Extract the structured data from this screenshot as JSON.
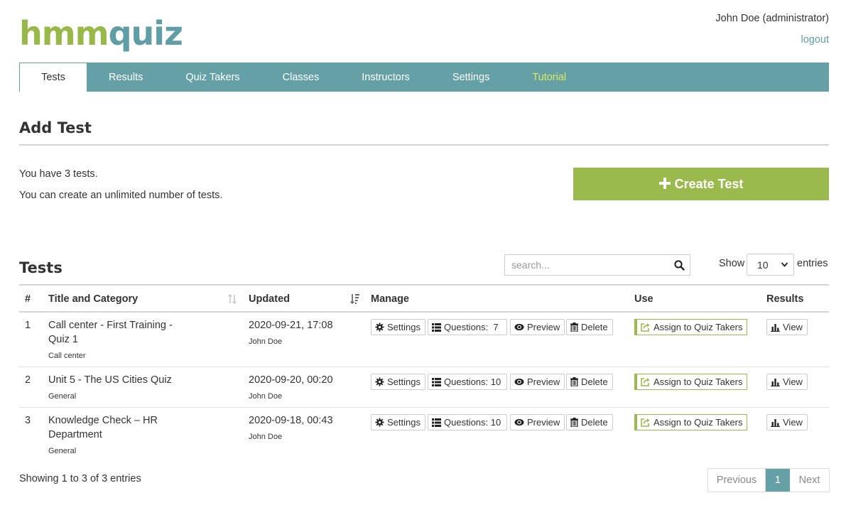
{
  "brand": {
    "logo_part1": "hmm",
    "logo_part2": "quiz"
  },
  "user": {
    "name": "John Doe (administrator)",
    "logout": "logout"
  },
  "nav": {
    "tabs": [
      "Tests",
      "Results",
      "Quiz Takers",
      "Classes",
      "Instructors",
      "Settings",
      "Tutorial"
    ],
    "active": "Tests"
  },
  "add_test": {
    "title": "Add Test",
    "count_text": "You have 3 tests.",
    "limit_text": "You can create an unlimited number of tests.",
    "create_button": "Create Test"
  },
  "tests": {
    "title": "Tests",
    "search_placeholder": "search...",
    "show_label": "Show",
    "entries_value": "10",
    "entries_label": "entries",
    "columns": [
      "#",
      "Title and Category",
      "Updated",
      "Manage",
      "Use",
      "Results"
    ],
    "rows": [
      {
        "num": "1",
        "title_line1": "Call center - First Training -",
        "title_line2": "Quiz 1",
        "category": "Call center",
        "updated": "2020-09-21, 17:08",
        "author": "John Doe",
        "questions": "Questions:  7"
      },
      {
        "num": "2",
        "title_line1": "Unit 5 - The US Cities Quiz",
        "title_line2": "",
        "category": "General",
        "updated": "2020-09-20, 00:20",
        "author": "John Doe",
        "questions": "Questions: 10"
      },
      {
        "num": "3",
        "title_line1": "Knowledge Check – HR",
        "title_line2": "Department",
        "category": "General",
        "updated": "2020-09-18, 00:43",
        "author": "John Doe",
        "questions": "Questions: 10"
      }
    ],
    "buttons": {
      "settings": "Settings",
      "preview": "Preview",
      "delete": "Delete",
      "assign": "Assign to Quiz Takers",
      "view": "View"
    },
    "showing_text": "Showing 1 to 3 of 3 entries",
    "pagination": {
      "previous": "Previous",
      "page": "1",
      "next": "Next"
    }
  },
  "colors": {
    "brand_green": "#9bba4d",
    "brand_teal": "#64a0a6",
    "tutorial_yellow": "#d8ec5a"
  }
}
